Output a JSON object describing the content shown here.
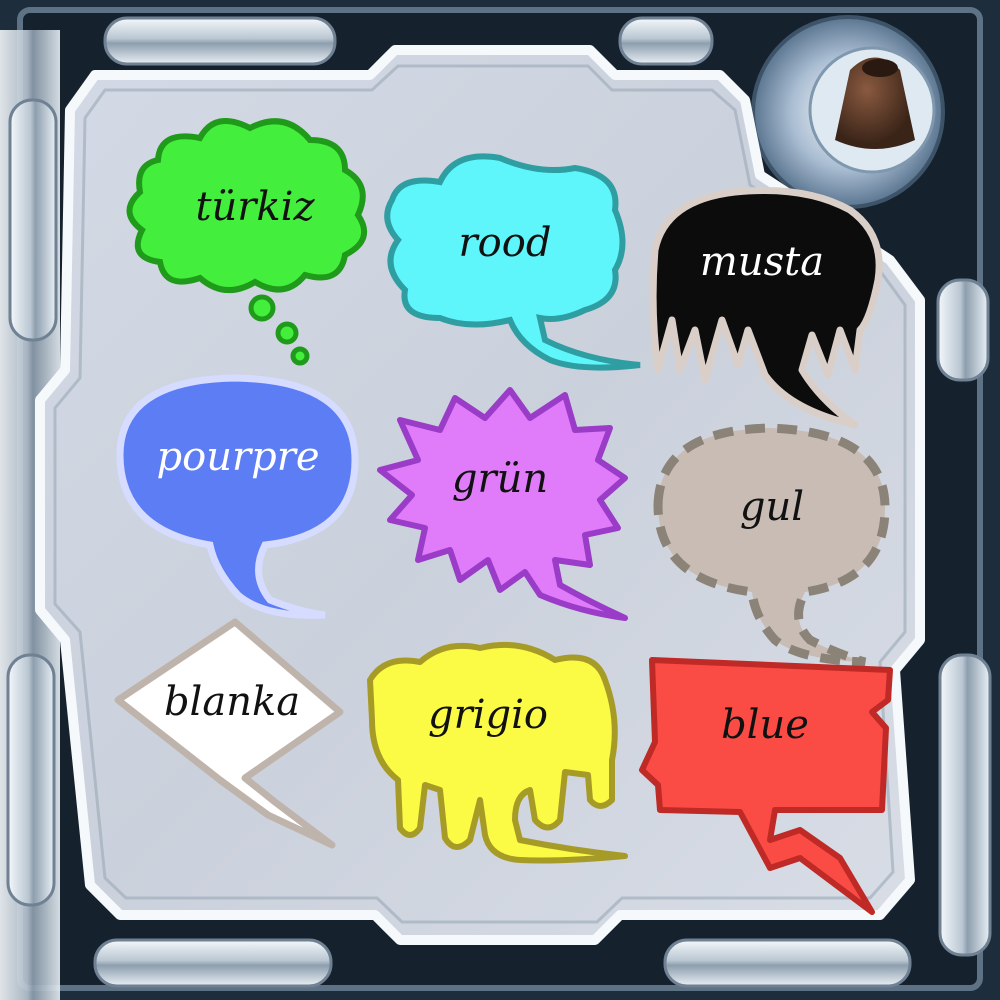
{
  "bubbles": [
    {
      "id": "green-cloud",
      "word": "türkiz",
      "fill": "#44ee3c",
      "stroke": "#1f9a1a",
      "text_color": "#111111"
    },
    {
      "id": "cyan-speech",
      "word": "rood",
      "fill": "#5ef6fb",
      "stroke": "#2f9ea2",
      "text_color": "#111111"
    },
    {
      "id": "black-spiky",
      "word": "musta",
      "fill": "#0c0c0c",
      "stroke": "#d9cfc8",
      "text_color": "#ffffff"
    },
    {
      "id": "blue-oval",
      "word": "pourpre",
      "fill": "#5d7df4",
      "stroke": "#d6dcff",
      "text_color": "#ffffff"
    },
    {
      "id": "purple-burst",
      "word": "grün",
      "fill": "#e07cf9",
      "stroke": "#9a3cc8",
      "text_color": "#111111"
    },
    {
      "id": "taupe-dashed",
      "word": "gul",
      "fill": "#c8bcb4",
      "stroke": "#8b8378",
      "text_color": "#111111"
    },
    {
      "id": "white-diamond",
      "word": "blanka",
      "fill": "#ffffff",
      "stroke": "#bfb4ac",
      "text_color": "#111111"
    },
    {
      "id": "yellow-drip",
      "word": "grigio",
      "fill": "#fbfb45",
      "stroke": "#a79b28",
      "text_color": "#111111"
    },
    {
      "id": "red-banner",
      "word": "blue",
      "fill": "#fa4b45",
      "stroke": "#bf2a26",
      "text_color": "#111111"
    }
  ]
}
